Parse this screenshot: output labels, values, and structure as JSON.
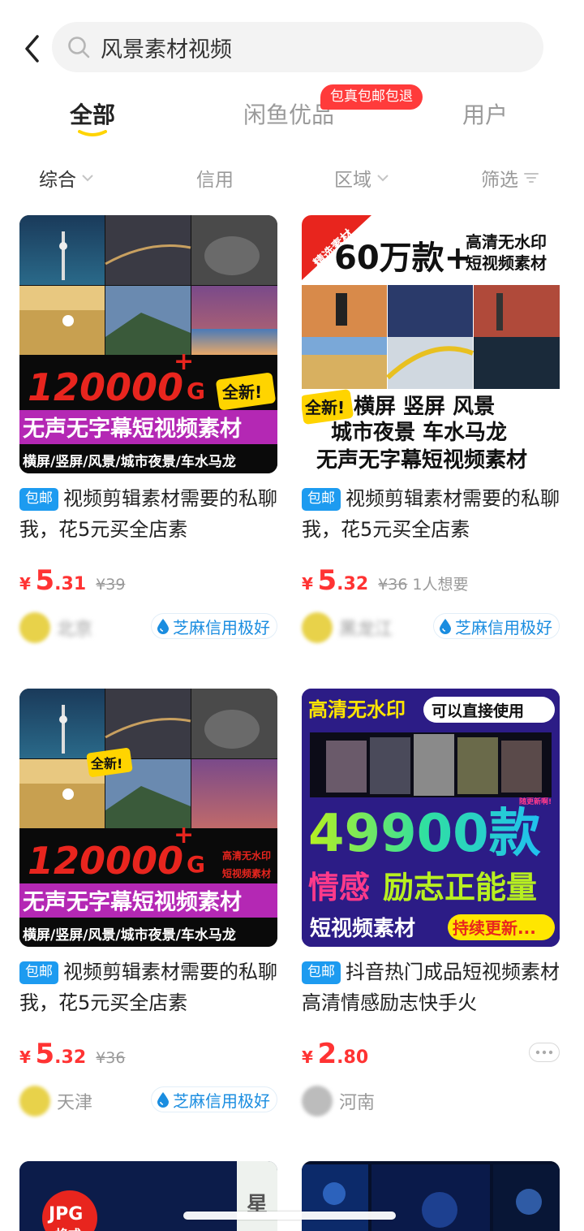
{
  "search": {
    "query": "风景素材视频"
  },
  "tabs": [
    {
      "label": "全部"
    },
    {
      "label": "闲鱼优品"
    },
    {
      "label": "用户"
    }
  ],
  "promo_badge": "包真包邮包退",
  "filters": [
    {
      "label": "综合"
    },
    {
      "label": "信用"
    },
    {
      "label": "区域"
    },
    {
      "label": "筛选"
    }
  ],
  "colors": {
    "accent_yellow": "#ffd400",
    "price_red": "#ff3333",
    "tag_blue": "#1d9bf0",
    "credit_blue": "#1a8de0"
  },
  "products": [
    {
      "tag": "包邮",
      "title": "视频剪辑素材需要的私聊我，花5元买全店素",
      "price_yen": "¥",
      "price_int": "5",
      "price_dec": ".31",
      "original_price": "¥39",
      "wants": "",
      "location": "北京",
      "credit": "芝麻信用极好",
      "img": {
        "big": "120000",
        "big_sup": "+",
        "big_unit": "G",
        "sub": "无声无字幕短视频素材",
        "foot": "横屏/竖屏/风景/城市夜景/车水马龙",
        "badge": "全新!"
      }
    },
    {
      "tag": "包邮",
      "title": "视频剪辑素材需要的私聊我，花5元买全店素",
      "price_yen": "¥",
      "price_int": "5",
      "price_dec": ".32",
      "original_price": "¥36",
      "wants": "1人想要",
      "location": "黑龙江",
      "credit": "芝麻信用极好",
      "img": {
        "ribbon": "精选素材",
        "head_big": "60万款+",
        "head_r1": "高清无水印",
        "head_r2": "短视频素材",
        "line1": "横屏  竖屏  风景",
        "line2": "城市夜景  车水马龙",
        "line3": "无声无字幕短视频素材",
        "badge": "全新!"
      }
    },
    {
      "tag": "包邮",
      "title": "视频剪辑素材需要的私聊我，花5元买全店素",
      "price_yen": "¥",
      "price_int": "5",
      "price_dec": ".32",
      "original_price": "¥36",
      "wants": "",
      "location": "天津",
      "credit": "芝麻信用极好",
      "img": {
        "big": "120000",
        "big_sup": "+",
        "big_unit": "G",
        "side1": "高清无水印",
        "side2": "短视频素材",
        "sub": "无声无字幕短视频素材",
        "foot": "横屏/竖屏/风景/城市夜景/车水马龙",
        "badge": "全新!"
      }
    },
    {
      "tag": "包邮",
      "title": "抖音热门成品短视频素材高清情感励志快手火",
      "price_yen": "¥",
      "price_int": "2",
      "price_dec": ".80",
      "original_price": "",
      "wants": "",
      "location": "河南",
      "credit": "",
      "img": {
        "head_l": "高清无水印",
        "head_r": "可以直接使用",
        "big": "49900款",
        "mid_l": "情感",
        "mid_r": "励志正能量",
        "foot_l": "短视频素材",
        "foot_r": "持续更新...",
        "tiny": "随更新啊!"
      }
    }
  ],
  "partial_products": [
    {
      "img": {
        "corner": "JPG",
        "corner2": "格式",
        "side": "星"
      }
    },
    {
      "img": {}
    }
  ]
}
